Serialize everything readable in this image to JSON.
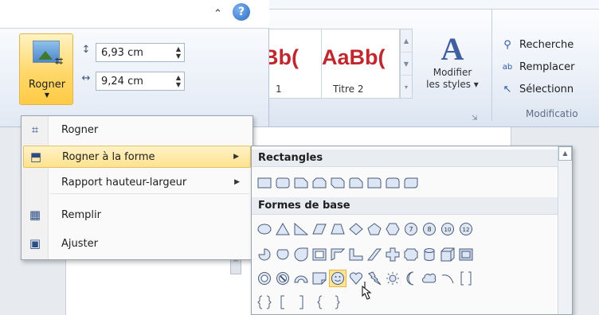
{
  "picture_tools": {
    "crop_label": "Rogner",
    "height_value": "6,93 cm",
    "width_value": "9,24 cm"
  },
  "home_ribbon": {
    "style_partial_1": "Bb(",
    "style_caption_1": "1",
    "style_sample_2": "AaBb(",
    "style_caption_2": "Titre 2",
    "modify_styles": [
      "Modifier",
      "les styles ▾"
    ],
    "editing_items": [
      "Recherche",
      "Remplacer",
      "Sélectionn"
    ],
    "editing_group_label": "Modificatio"
  },
  "crop_menu": {
    "items": [
      {
        "label": "Rogner",
        "icon": "crop-icon"
      },
      {
        "label": "Rogner à la forme",
        "icon": "crop-to-shape-icon",
        "submenu": true
      },
      {
        "label": "Rapport hauteur-largeur",
        "icon": "",
        "submenu": true
      },
      {
        "label": "Remplir",
        "icon": "fill-icon"
      },
      {
        "label": "Ajuster",
        "icon": "fit-icon"
      }
    ]
  },
  "shapes_menu": {
    "categories": [
      "Rectangles",
      "Formes de base"
    ],
    "hovered_shape": "smiley-face"
  },
  "colors": {
    "accent_hover": "#ffe28e",
    "title_red": "#c0282f",
    "shape_stroke": "#4a5c78",
    "shape_fill": "#dce6f4"
  }
}
